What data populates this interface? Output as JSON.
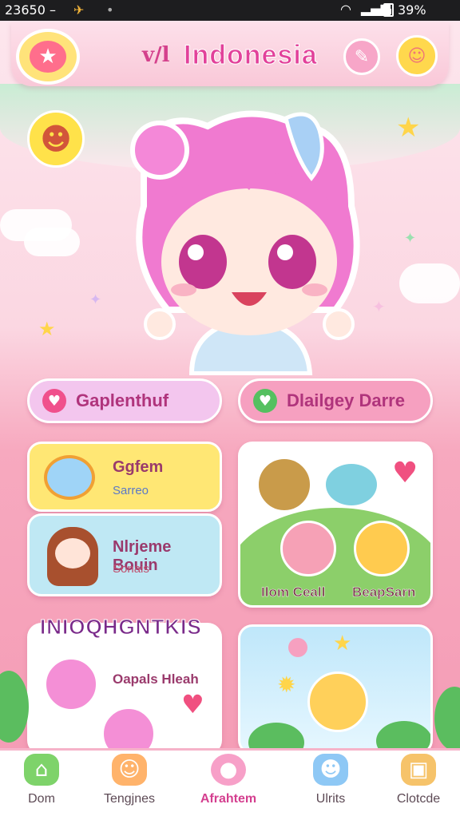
{
  "status_bar": {
    "time": "23650 –",
    "battery": "39%"
  },
  "header": {
    "prefix": "v/l",
    "title": "Indonesia"
  },
  "pills": [
    {
      "label": "Gaplenthuf",
      "color": "#f0508c"
    },
    {
      "label": "Dlailgey Darre",
      "color": "#55c060"
    }
  ],
  "cards": {
    "game": {
      "title": "Ggfem",
      "subtitle": "Sarreo"
    },
    "character": {
      "title": "Nlrjeme Bouin",
      "subtitle": "Sonais"
    },
    "animals": {
      "label_left": "Ilom Ceall",
      "label_right": "BeapSarn"
    }
  },
  "section": {
    "heading": "INIOQHGNTKIS",
    "item_label": "Oapals Hleah"
  },
  "nav": [
    {
      "label": "Dom",
      "icon": "home-icon"
    },
    {
      "label": "Tengjnes",
      "icon": "character-icon"
    },
    {
      "label": "Afrahtem",
      "icon": "blob-icon"
    },
    {
      "label": "Ulrits",
      "icon": "robot-icon"
    },
    {
      "label": "Clotcde",
      "icon": "box-icon"
    }
  ],
  "colors": {
    "accent": "#e2419a",
    "pink_bg": "#f49ab4"
  }
}
